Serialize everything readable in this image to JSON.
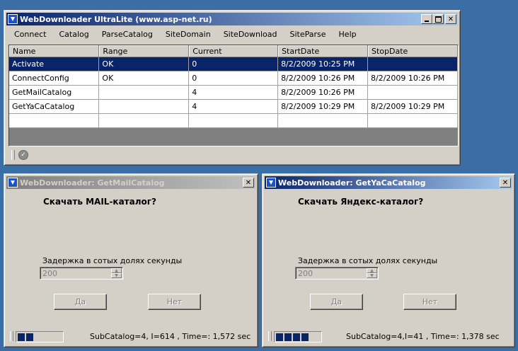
{
  "main_window": {
    "title": "WebDownloader UltraLite  (www.asp-net.ru)",
    "menu": [
      "Connect",
      "Catalog",
      "ParseCatalog",
      "SiteDomain",
      "SiteDownload",
      "SiteParse",
      "Help"
    ],
    "columns": [
      "Name",
      "Range",
      "Current",
      "StartDate",
      "StopDate"
    ],
    "rows": [
      [
        "Activate",
        "OK",
        "0",
        "8/2/2009 10:25 PM",
        ""
      ],
      [
        "ConnectConfig",
        "OK",
        "0",
        "8/2/2009 10:26 PM",
        "8/2/2009 10:26 PM"
      ],
      [
        "GetMailCatalog",
        "",
        "4",
        "8/2/2009 10:26 PM",
        ""
      ],
      [
        "GetYaCaCatalog",
        "",
        "4",
        "8/2/2009 10:29 PM",
        "8/2/2009 10:29 PM"
      ],
      [
        "",
        "",
        "",
        "",
        ""
      ]
    ],
    "selected_row": 0
  },
  "dialog_mail": {
    "title": "WebDownloader: GetMailCatalog",
    "prompt": "Скачать MAIL-каталог?",
    "delay_label": "Задержка в сотых долях секунды",
    "delay_value": "200",
    "yes_label": "Да",
    "no_label": "Нет",
    "progress_blocks": 2,
    "status": "SubCatalog=4, I=614   , Time=: 1,572 sec"
  },
  "dialog_yaca": {
    "title": "WebDownloader: GetYaCaCatalog",
    "prompt": "Скачать Яндекс-каталог?",
    "delay_label": "Задержка в сотых долях секунды",
    "delay_value": "200",
    "yes_label": "Да",
    "no_label": "Нет",
    "progress_blocks": 4,
    "status": "SubCatalog=4,I=41   , Time=: 1,378 sec"
  },
  "colors": {
    "desktop": "#3a6ea5",
    "active_title": "#0a246a",
    "face": "#d4d0c8"
  }
}
